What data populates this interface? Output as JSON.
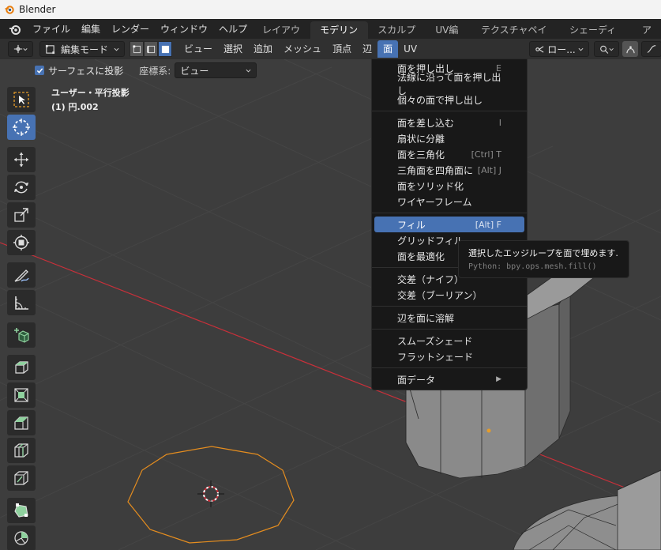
{
  "titlebar": {
    "title": "Blender"
  },
  "menubar": {
    "items": [
      "ファイル",
      "編集",
      "レンダー",
      "ウィンドウ",
      "ヘルプ"
    ],
    "workspaces": [
      "レイアウト",
      "モデリング",
      "スカルプト",
      "UV編集",
      "テクスチャペイント",
      "シェーディング",
      "ア"
    ],
    "active_workspace": "モデリング"
  },
  "header": {
    "mode": "編集モード",
    "menus": [
      "ビュー",
      "選択",
      "追加",
      "メッシュ",
      "頂点",
      "辺",
      "面",
      "UV"
    ],
    "open_menu": "面",
    "pivot": "ロー..."
  },
  "viewport": {
    "surface_project_label": "サーフェスに投影",
    "coord_label": "座標系:",
    "coord_value": "ビュー",
    "info_line1": "ユーザー・平行投影",
    "info_line2": "(1) 円.002"
  },
  "face_menu": {
    "items": [
      {
        "label": "面を押し出し",
        "shortcut": "E"
      },
      {
        "label": "法線に沿って面を押し出し",
        "shortcut": ""
      },
      {
        "label": "個々の面で押し出し",
        "shortcut": ""
      },
      {
        "label": "面を差し込む",
        "shortcut": "I"
      },
      {
        "label": "扇状に分離",
        "shortcut": ""
      },
      {
        "label": "面を三角化",
        "shortcut": "[Ctrl] T"
      },
      {
        "label": "三角面を四角面に",
        "shortcut": "[Alt] J"
      },
      {
        "label": "面をソリッド化",
        "shortcut": ""
      },
      {
        "label": "ワイヤーフレーム",
        "shortcut": ""
      },
      {
        "label": "フィル",
        "shortcut": "[Alt] F"
      },
      {
        "label": "グリッドフィル",
        "shortcut": ""
      },
      {
        "label": "面を最適化",
        "shortcut": ""
      },
      {
        "label": "交差（ナイフ）",
        "shortcut": ""
      },
      {
        "label": "交差（ブーリアン）",
        "shortcut": ""
      },
      {
        "label": "辺を面に溶解",
        "shortcut": ""
      },
      {
        "label": "スムーズシェード",
        "shortcut": ""
      },
      {
        "label": "フラットシェード",
        "shortcut": ""
      },
      {
        "label": "面データ",
        "shortcut": ""
      }
    ],
    "highlighted": "フィル"
  },
  "tooltip": {
    "description": "選択したエッジループを面で埋めます.",
    "python": "Python: bpy.ops.mesh.fill()"
  },
  "colors": {
    "accent": "#4772b3",
    "viewport_bg": "#3d3d3d",
    "menu_bg": "#181818",
    "selection_orange": "#e58d1f",
    "x_axis": "#c8303a"
  }
}
